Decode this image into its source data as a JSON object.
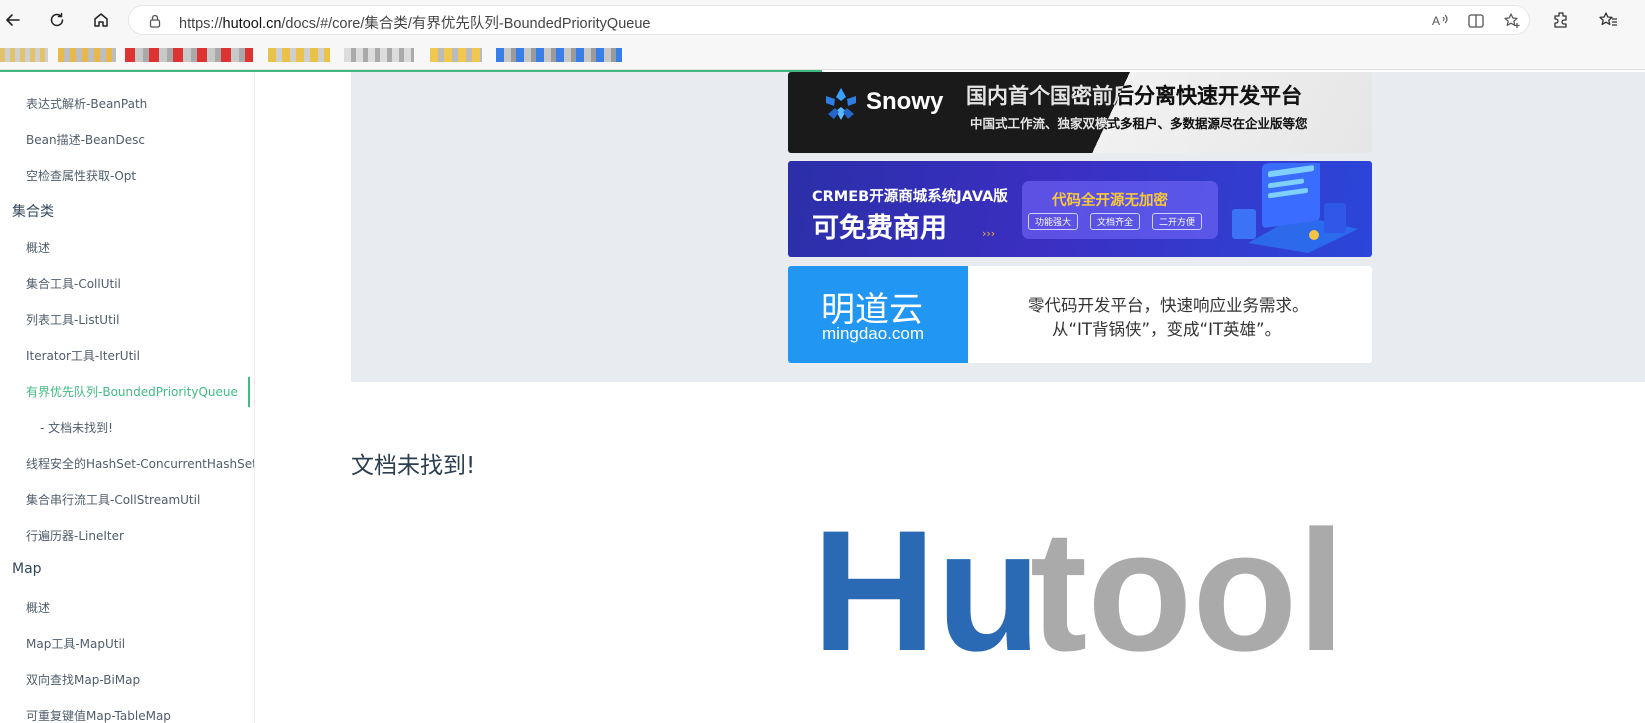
{
  "browser": {
    "url_prefix": "https://",
    "url_domain": "hutool.cn",
    "url_path": "/docs/#/core/集合类/有界优先队列-BoundedPriorityQueue",
    "icons": [
      "back-icon",
      "refresh-icon",
      "home-icon",
      "lock-icon",
      "read-aloud-icon",
      "split-screen-icon",
      "add-favorite-icon",
      "extensions-icon",
      "favorites-icon"
    ]
  },
  "sidebar": {
    "items_top": [
      {
        "label": "表达式解析-BeanPath"
      },
      {
        "label": "Bean描述-BeanDesc"
      },
      {
        "label": "空检查属性获取-Opt"
      }
    ],
    "section_collections": "集合类",
    "items_collections": [
      {
        "label": "概述"
      },
      {
        "label": "集合工具-CollUtil"
      },
      {
        "label": "列表工具-ListUtil"
      },
      {
        "label": "Iterator工具-IterUtil"
      },
      {
        "label": "有界优先队列-BoundedPriorityQueue",
        "active": true
      }
    ],
    "sub_item": "- 文档未找到!",
    "items_collections_2": [
      {
        "label": "线程安全的HashSet-ConcurrentHashSet"
      },
      {
        "label": "集合串行流工具-CollStreamUtil"
      },
      {
        "label": "行遍历器-LineIter"
      }
    ],
    "section_map": "Map",
    "items_map": [
      {
        "label": "概述"
      },
      {
        "label": "Map工具-MapUtil"
      },
      {
        "label": "双向查找Map-BiMap"
      },
      {
        "label": "可重复键值Map-TableMap"
      }
    ]
  },
  "ads": {
    "snowy": {
      "brand": "Snowy",
      "headline": "国内首个国密前后分离快速开发平台",
      "sub": "中国式工作流、独家双模式多租户、多数据源尽在企业版等您"
    },
    "crmeb": {
      "title": "CRMEB开源商城系统JAVA版",
      "big": "可免费商用",
      "badge": "代码全开源无加密",
      "tags": [
        "功能强大",
        "文档齐全",
        "二开方便"
      ]
    },
    "mingdao": {
      "brand_cn": "明道云",
      "brand_en": "mingdao.com",
      "line1": "零代码开发平台，快速响应业务需求。",
      "line2": "从“IT背锅侠”，变成“IT英雄”。"
    }
  },
  "main": {
    "heading": "文档未找到!",
    "logo_text_blue": "Hu",
    "logo_text_gray": "tool"
  },
  "colors": {
    "accent": "#42b983",
    "logo_blue": "#2a6ab5",
    "logo_gray": "#aaaaaa",
    "ad_bg": "#e8ebef"
  }
}
